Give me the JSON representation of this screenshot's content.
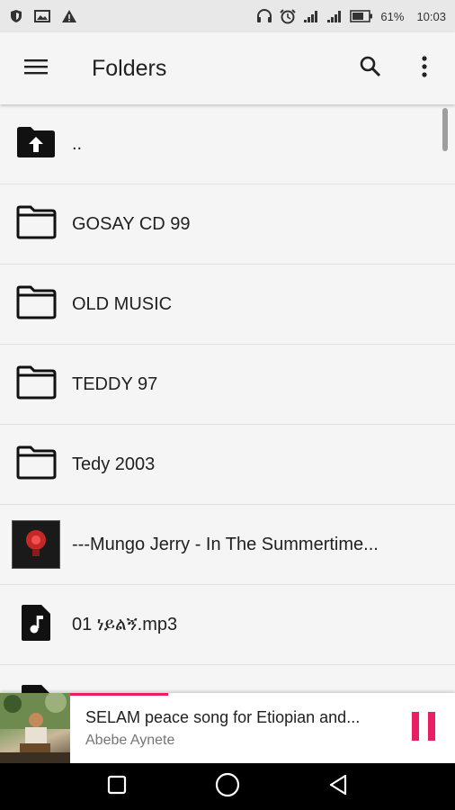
{
  "status_bar": {
    "battery": "61%",
    "time": "10:03"
  },
  "app_bar": {
    "title": "Folders",
    "icons": [
      "menu-icon",
      "search-icon",
      "more-vert-icon"
    ]
  },
  "list": {
    "items": [
      {
        "type": "parent",
        "icon": "folder-up-icon",
        "label": ".."
      },
      {
        "type": "folder",
        "icon": "folder-icon",
        "label": "GOSAY CD 99"
      },
      {
        "type": "folder",
        "icon": "folder-icon",
        "label": "OLD MUSIC"
      },
      {
        "type": "folder",
        "icon": "folder-icon",
        "label": "TEDDY 97"
      },
      {
        "type": "folder",
        "icon": "folder-icon",
        "label": "Tedy 2003"
      },
      {
        "type": "album",
        "icon": "album-art",
        "label": "---Mungo Jerry - In The Summertime..."
      },
      {
        "type": "file",
        "icon": "music-file-icon",
        "label": "01 ነይልኝ.mp3"
      },
      {
        "type": "file",
        "icon": "music-file-icon",
        "label": ""
      }
    ]
  },
  "now_playing": {
    "title": "SELAM peace song for Etiopian and...",
    "artist": "Abebe Aynete",
    "progress": 0.37,
    "accent": "#e91e63"
  },
  "nav_bar": {
    "icons": [
      "recents-icon",
      "home-icon",
      "back-icon"
    ]
  }
}
